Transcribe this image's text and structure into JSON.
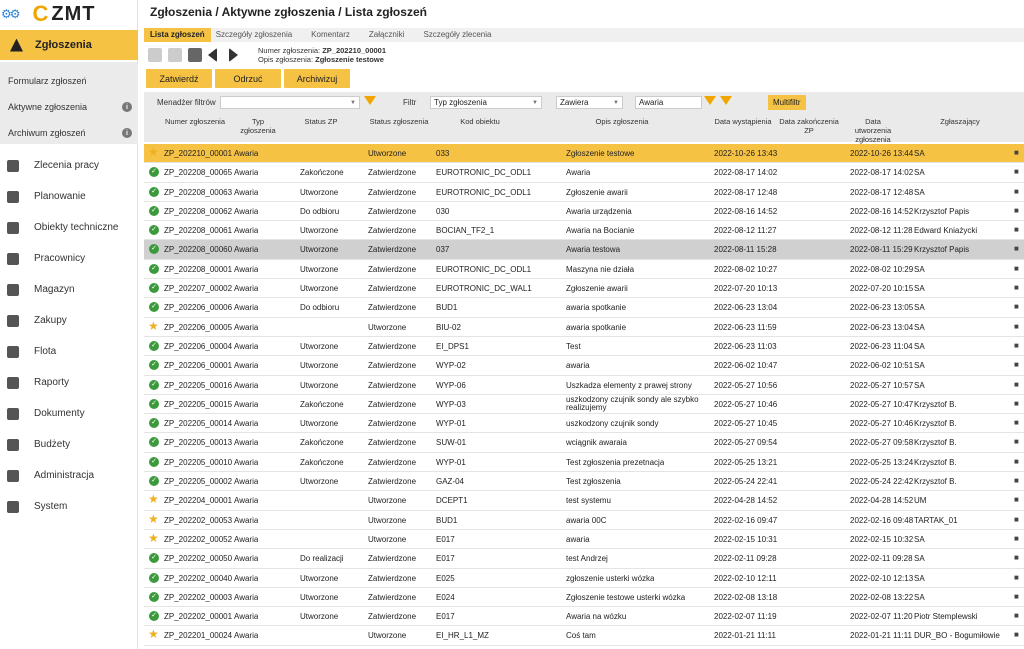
{
  "app": {
    "logo": "ZMT",
    "logo_letter": "C"
  },
  "sidebar": {
    "active": "Zgłoszenia",
    "sub": [
      {
        "label": "Formularz zgłoszeń",
        "info": false
      },
      {
        "label": "Aktywne zgłoszenia",
        "info": true
      },
      {
        "label": "Archiwum zgłoszeń",
        "info": true
      }
    ],
    "modules": [
      "Zlecenia pracy",
      "Planowanie",
      "Obiekty techniczne",
      "Pracownicy",
      "Magazyn",
      "Zakupy",
      "Flota",
      "Raporty",
      "Dokumenty",
      "Budżety",
      "Administracja",
      "System"
    ]
  },
  "breadcrumb": "Zgłoszenia / Aktywne zgłoszenia / Lista zgłoszeń",
  "tabs": [
    "Lista zgłoszeń",
    "Szczegóły zgłoszenia",
    "Komentarz",
    "Załączniki",
    "Szczegóły zlecenia"
  ],
  "toolbar": {
    "num_label": "Numer zgłoszenia:",
    "num_value": "ZP_202210_00001",
    "desc_label": "Opis zgłoszenia:",
    "desc_value": "Zgłoszenie testowe"
  },
  "actions": [
    "Zatwierdź",
    "Odrzuć",
    "Archiwizuj"
  ],
  "filters": {
    "manager_label": "Menadżer filtrów",
    "manager_value": "",
    "filter_label": "Filtr",
    "field": "Typ zgłoszenia",
    "op": "Zawiera",
    "value": "Awaria",
    "multifiltr": "Multifiltr"
  },
  "columns": [
    "Numer zgłoszenia",
    "Typ zgłoszenia",
    "Status ZP",
    "Status zgłoszenia",
    "Kod obiektu",
    "Opis zgłoszenia",
    "Data wystąpienia",
    "Data zakończenia ZP",
    "Data utworzenia zgłoszenia",
    "Zgłaszający"
  ],
  "rows": [
    {
      "icon": "star",
      "num": "ZP_202210_00001",
      "type": "Awaria",
      "zp": "",
      "status": "Utworzone",
      "obj": "033",
      "desc": "Zgłoszenie testowe",
      "occ": "2022-10-26 13:43",
      "end": "",
      "created": "2022-10-26 13:44",
      "rep": "SA",
      "hl": "sel1"
    },
    {
      "icon": "check",
      "num": "ZP_202208_00065",
      "type": "Awaria",
      "zp": "Zakończone",
      "status": "Zatwierdzone",
      "obj": "EUROTRONIC_DC_ODL1",
      "desc": "Awaria",
      "occ": "2022-08-17 14:02",
      "end": "",
      "created": "2022-08-17 14:02",
      "rep": "SA",
      "hl": ""
    },
    {
      "icon": "check",
      "num": "ZP_202208_00063",
      "type": "Awaria",
      "zp": "Utworzone",
      "status": "Zatwierdzone",
      "obj": "EUROTRONIC_DC_ODL1",
      "desc": "Zgłoszenie awarii",
      "occ": "2022-08-17 12:48",
      "end": "",
      "created": "2022-08-17 12:48",
      "rep": "SA",
      "hl": ""
    },
    {
      "icon": "check",
      "num": "ZP_202208_00062",
      "type": "Awaria",
      "zp": "Do odbioru",
      "status": "Zatwierdzone",
      "obj": "030",
      "desc": "Awaria urządzenia",
      "occ": "2022-08-16 14:52",
      "end": "",
      "created": "2022-08-16 14:52",
      "rep": "Krzysztof Papis",
      "hl": ""
    },
    {
      "icon": "check",
      "num": "ZP_202208_00061",
      "type": "Awaria",
      "zp": "Utworzone",
      "status": "Zatwierdzone",
      "obj": "BOCIAN_TF2_1",
      "desc": "Awaria na Bocianie",
      "occ": "2022-08-12 11:27",
      "end": "",
      "created": "2022-08-12 11:28",
      "rep": "Edward Kniażycki",
      "hl": ""
    },
    {
      "icon": "check",
      "num": "ZP_202208_00060",
      "type": "Awaria",
      "zp": "Utworzone",
      "status": "Zatwierdzone",
      "obj": "037",
      "desc": "Awaria testowa",
      "occ": "2022-08-11 15:28",
      "end": "",
      "created": "2022-08-11 15:29",
      "rep": "Krzysztof Papis",
      "hl": "sel2"
    },
    {
      "icon": "check",
      "num": "ZP_202208_00001",
      "type": "Awaria",
      "zp": "Utworzone",
      "status": "Zatwierdzone",
      "obj": "EUROTRONIC_DC_ODL1",
      "desc": "Maszyna nie działa",
      "occ": "2022-08-02 10:27",
      "end": "",
      "created": "2022-08-02 10:29",
      "rep": "SA",
      "hl": ""
    },
    {
      "icon": "check",
      "num": "ZP_202207_00002",
      "type": "Awaria",
      "zp": "Utworzone",
      "status": "Zatwierdzone",
      "obj": "EUROTRONIC_DC_WAL1",
      "desc": "Zgłoszenie awarii",
      "occ": "2022-07-20 10:13",
      "end": "",
      "created": "2022-07-20 10:15",
      "rep": "SA",
      "hl": ""
    },
    {
      "icon": "check",
      "num": "ZP_202206_00006",
      "type": "Awaria",
      "zp": "Do odbioru",
      "status": "Zatwierdzone",
      "obj": "BUD1",
      "desc": "awaria spotkanie",
      "occ": "2022-06-23 13:04",
      "end": "",
      "created": "2022-06-23 13:05",
      "rep": "SA",
      "hl": ""
    },
    {
      "icon": "star",
      "num": "ZP_202206_00005",
      "type": "Awaria",
      "zp": "",
      "status": "Utworzone",
      "obj": "BIU-02",
      "desc": "awaria spotkanie",
      "occ": "2022-06-23 11:59",
      "end": "",
      "created": "2022-06-23 13:04",
      "rep": "SA",
      "hl": ""
    },
    {
      "icon": "check",
      "num": "ZP_202206_00004",
      "type": "Awaria",
      "zp": "Utworzone",
      "status": "Zatwierdzone",
      "obj": "EI_DPS1",
      "desc": "Test",
      "occ": "2022-06-23 11:03",
      "end": "",
      "created": "2022-06-23 11:04",
      "rep": "SA",
      "hl": ""
    },
    {
      "icon": "check",
      "num": "ZP_202206_00001",
      "type": "Awaria",
      "zp": "Utworzone",
      "status": "Zatwierdzone",
      "obj": "WYP-02",
      "desc": "awaria",
      "occ": "2022-06-02 10:47",
      "end": "",
      "created": "2022-06-02 10:51",
      "rep": "SA",
      "hl": ""
    },
    {
      "icon": "check",
      "num": "ZP_202205_00016",
      "type": "Awaria",
      "zp": "Utworzone",
      "status": "Zatwierdzone",
      "obj": "WYP-06",
      "desc": "Uszkadza elementy z prawej strony",
      "occ": "2022-05-27 10:56",
      "end": "",
      "created": "2022-05-27 10:57",
      "rep": "SA",
      "hl": ""
    },
    {
      "icon": "check",
      "num": "ZP_202205_00015",
      "type": "Awaria",
      "zp": "Zakończone",
      "status": "Zatwierdzone",
      "obj": "WYP-03",
      "desc": "uszkodzony czujnik sondy ale szybko realizujemy",
      "occ": "2022-05-27 10:46",
      "end": "",
      "created": "2022-05-27 10:47",
      "rep": "Krzysztof B.",
      "hl": "",
      "wrap": true
    },
    {
      "icon": "check",
      "num": "ZP_202205_00014",
      "type": "Awaria",
      "zp": "Utworzone",
      "status": "Zatwierdzone",
      "obj": "WYP-01",
      "desc": "uszkodzony czujnik sondy",
      "occ": "2022-05-27 10:45",
      "end": "",
      "created": "2022-05-27 10:46",
      "rep": "Krzysztof B.",
      "hl": ""
    },
    {
      "icon": "check",
      "num": "ZP_202205_00013",
      "type": "Awaria",
      "zp": "Zakończone",
      "status": "Zatwierdzone",
      "obj": "SUW-01",
      "desc": "wciągnik awaraia",
      "occ": "2022-05-27 09:54",
      "end": "",
      "created": "2022-05-27 09:58",
      "rep": "Krzysztof B.",
      "hl": ""
    },
    {
      "icon": "check",
      "num": "ZP_202205_00010",
      "type": "Awaria",
      "zp": "Zakończone",
      "status": "Zatwierdzone",
      "obj": "WYP-01",
      "desc": "Test zgłoszenia prezetnacja",
      "occ": "2022-05-25 13:21",
      "end": "",
      "created": "2022-05-25 13:24",
      "rep": "Krzysztof B.",
      "hl": ""
    },
    {
      "icon": "check",
      "num": "ZP_202205_00002",
      "type": "Awaria",
      "zp": "Utworzone",
      "status": "Zatwierdzone",
      "obj": "GAZ-04",
      "desc": "Test zgłoszenia",
      "occ": "2022-05-24 22:41",
      "end": "",
      "created": "2022-05-24 22:42",
      "rep": "Krzysztof B.",
      "hl": ""
    },
    {
      "icon": "star",
      "num": "ZP_202204_00001",
      "type": "Awaria",
      "zp": "",
      "status": "Utworzone",
      "obj": "DCEPT1",
      "desc": "test systemu",
      "occ": "2022-04-28 14:52",
      "end": "",
      "created": "2022-04-28 14:52",
      "rep": "UM",
      "hl": ""
    },
    {
      "icon": "star",
      "num": "ZP_202202_00053",
      "type": "Awaria",
      "zp": "",
      "status": "Utworzone",
      "obj": "BUD1",
      "desc": "awaria 00C",
      "occ": "2022-02-16 09:47",
      "end": "",
      "created": "2022-02-16 09:48",
      "rep": "TARTAK_01",
      "hl": ""
    },
    {
      "icon": "star",
      "num": "ZP_202202_00052",
      "type": "Awaria",
      "zp": "",
      "status": "Utworzone",
      "obj": "E017",
      "desc": "awaria",
      "occ": "2022-02-15 10:31",
      "end": "",
      "created": "2022-02-15 10:32",
      "rep": "SA",
      "hl": ""
    },
    {
      "icon": "check",
      "num": "ZP_202202_00050",
      "type": "Awaria",
      "zp": "Do realizacji",
      "status": "Zatwierdzone",
      "obj": "E017",
      "desc": "test Andrzej",
      "occ": "2022-02-11 09:28",
      "end": "",
      "created": "2022-02-11 09:28",
      "rep": "SA",
      "hl": ""
    },
    {
      "icon": "check",
      "num": "ZP_202202_00040",
      "type": "Awaria",
      "zp": "Utworzone",
      "status": "Zatwierdzone",
      "obj": "E025",
      "desc": "zgłoszenie usterki wózka",
      "occ": "2022-02-10 12:11",
      "end": "",
      "created": "2022-02-10 12:13",
      "rep": "SA",
      "hl": ""
    },
    {
      "icon": "check",
      "num": "ZP_202202_00003",
      "type": "Awaria",
      "zp": "Utworzone",
      "status": "Zatwierdzone",
      "obj": "E024",
      "desc": "Zgłoszenie testowe usterki wózka",
      "occ": "2022-02-08 13:18",
      "end": "",
      "created": "2022-02-08 13:22",
      "rep": "SA",
      "hl": ""
    },
    {
      "icon": "check",
      "num": "ZP_202202_00001",
      "type": "Awaria",
      "zp": "Utworzone",
      "status": "Zatwierdzone",
      "obj": "E017",
      "desc": "Awaria na wózku",
      "occ": "2022-02-07 11:19",
      "end": "",
      "created": "2022-02-07 11:20",
      "rep": "Piotr Stemplewski",
      "hl": ""
    },
    {
      "icon": "star",
      "num": "ZP_202201_00024",
      "type": "Awaria",
      "zp": "",
      "status": "Utworzone",
      "obj": "EI_HR_L1_MZ",
      "desc": "Coś tam",
      "occ": "2022-01-21 11:11",
      "end": "",
      "created": "2022-01-21 11:11",
      "rep": "DUR_BO - Bogumiłowie",
      "hl": ""
    }
  ]
}
